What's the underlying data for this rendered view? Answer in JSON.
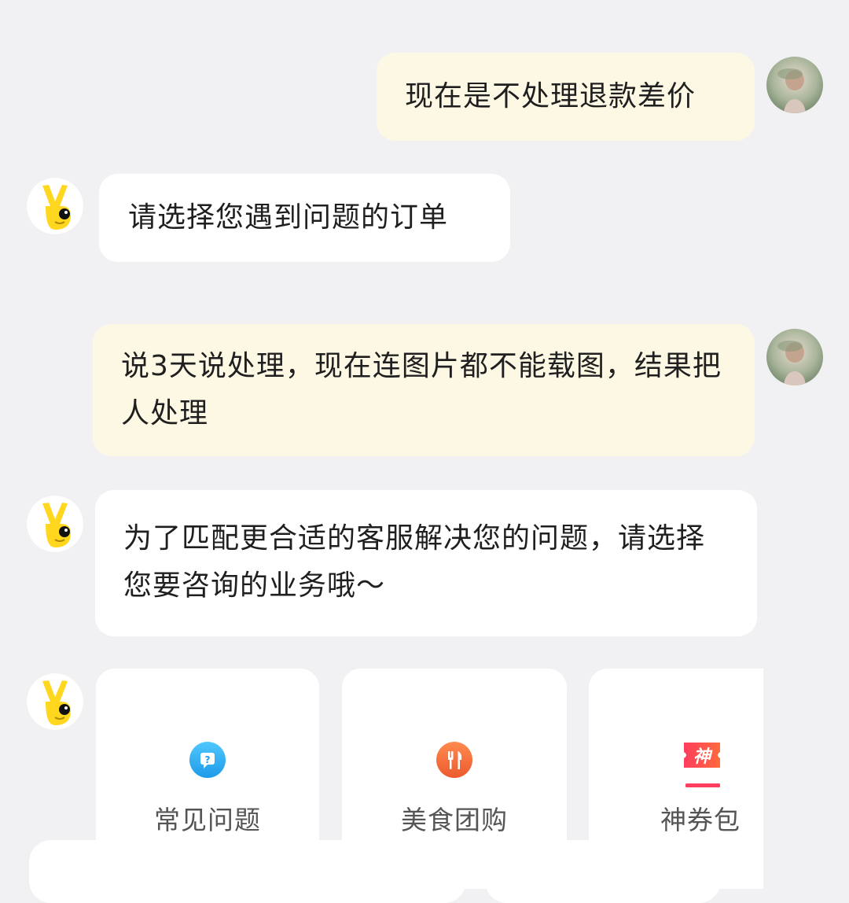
{
  "conversation": {
    "messages": [
      {
        "sender": "user",
        "text": "现在是不处理退款差价"
      },
      {
        "sender": "bot",
        "text": "请选择您遇到问题的订单"
      },
      {
        "sender": "user",
        "text": "说3天说处理，现在连图片都不能载图，结果把人处理"
      },
      {
        "sender": "bot",
        "text": "为了匹配更合适的客服解决您的问题，请选择您要咨询的业务哦～"
      }
    ]
  },
  "business_options": [
    {
      "label": "常见问题",
      "icon": "faq-icon",
      "color": "#29aef0"
    },
    {
      "label": "美食团购",
      "icon": "food-icon",
      "color": "#f1673a"
    },
    {
      "label": "神券包",
      "icon": "coupon-icon",
      "color": "#f0324f",
      "icon_text": "神"
    }
  ],
  "colors": {
    "background": "#f1f1f3",
    "user_bubble": "#fdf8e4",
    "bot_bubble": "#ffffff",
    "bot_avatar": "#ffd71f"
  }
}
